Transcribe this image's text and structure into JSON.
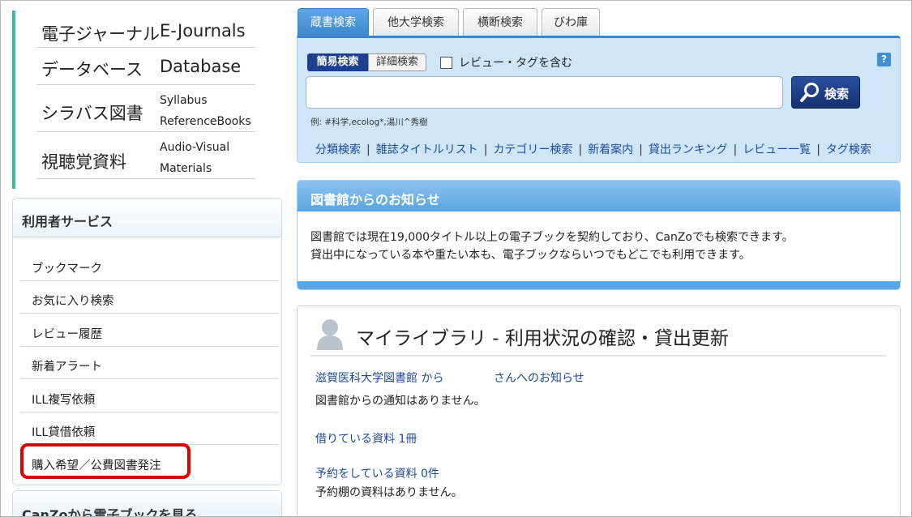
{
  "resources": [
    {
      "jp": "電子ジャーナル",
      "en": "E-Journals"
    },
    {
      "jp": "データベース",
      "en": "Database"
    },
    {
      "jp": "シラバス図書",
      "en_line1": "Syllabus",
      "en_line2": "ReferenceBooks"
    },
    {
      "jp": "視聴覚資料",
      "en_line1": "Audio-Visual",
      "en_line2": "Materials"
    }
  ],
  "user_services": {
    "title": "利用者サービス",
    "items": [
      "ブックマーク",
      "お気に入り検索",
      "レビュー履歴",
      "新着アラート",
      "ILL複写依頼",
      "ILL貸借依頼",
      "購入希望／公費図書発注"
    ]
  },
  "canzo": {
    "title": "CanZoから電子ブックを見る"
  },
  "tabs": [
    "蔵書検索",
    "他大学検索",
    "横断検索",
    "びわ庫"
  ],
  "search": {
    "mode_simple": "簡易検索",
    "mode_detail": "詳細検索",
    "checkbox_label": "レビュー・タグを含む",
    "help": "?",
    "input_value": "",
    "button_label": "検索",
    "example": "例: #科学,ecolog*,湯川^秀樹",
    "links": [
      "分類検索",
      "雑誌タイトルリスト",
      "カテゴリー検索",
      "新着案内",
      "貸出ランキング",
      "レビュー一覧",
      "タグ検索"
    ]
  },
  "notice": {
    "title": "図書館からのお知らせ",
    "line1": "図書館では現在19,000タイトル以上の電子ブックを契約しており、CanZoでも検索できます。",
    "line2": "貸出中になっている本や重たい本も、電子ブックならいつでもどこでも利用できます。"
  },
  "mylibrary": {
    "title": "マイライブラリ - 利用状況の確認・貸出更新",
    "from_library": "滋賀医科大学図書館 から",
    "to_user": "さんへのお知らせ",
    "no_notice": "図書館からの通知はありません。",
    "borrowed": "借りている資料 1冊",
    "reserved": "予約をしている資料 0件",
    "no_reserved": "予約棚の資料はありません。"
  },
  "colors": {
    "accent_teal": "#3fb8ae",
    "tab_active": "#3b86cf",
    "search_bg": "#cfe6f9",
    "button_navy": "#1e3f8f",
    "highlight_red": "#e00000",
    "link_blue": "#1e4a9a"
  }
}
